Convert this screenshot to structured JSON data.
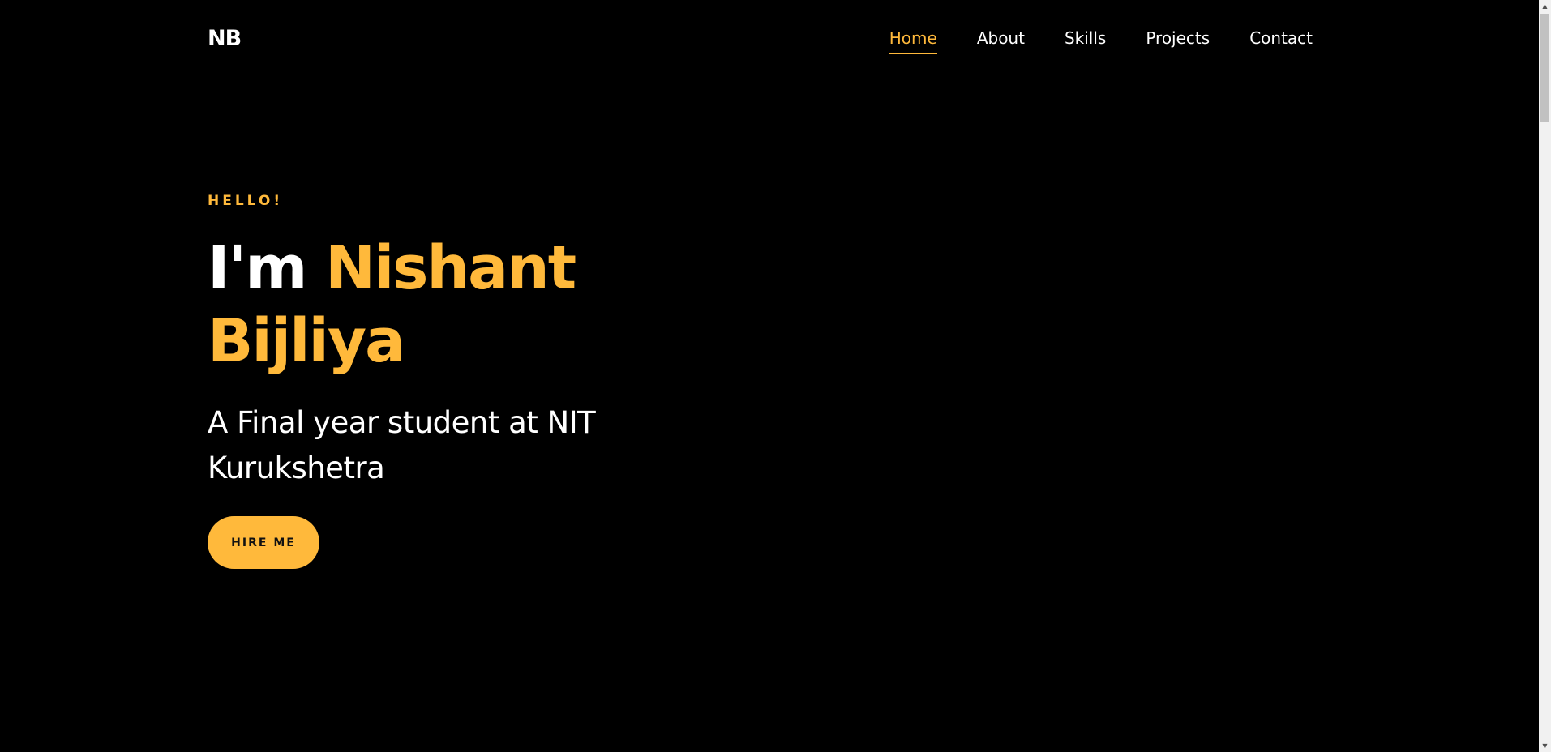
{
  "header": {
    "logo": "NB",
    "nav": [
      {
        "label": "Home",
        "active": true
      },
      {
        "label": "About",
        "active": false
      },
      {
        "label": "Skills",
        "active": false
      },
      {
        "label": "Projects",
        "active": false
      },
      {
        "label": "Contact",
        "active": false
      }
    ]
  },
  "hero": {
    "greeting": "HELLO!",
    "title_prefix": "I'm",
    "title_name": "Nishant Bijliya",
    "subtitle": "A Final year student at NIT Kurukshetra",
    "cta_label": "HIRE ME"
  },
  "scrollbar": {
    "up_icon": "▲",
    "down_icon": "▼"
  },
  "colors": {
    "background": "#000000",
    "accent": "#ffb93b",
    "text": "#ffffff"
  }
}
